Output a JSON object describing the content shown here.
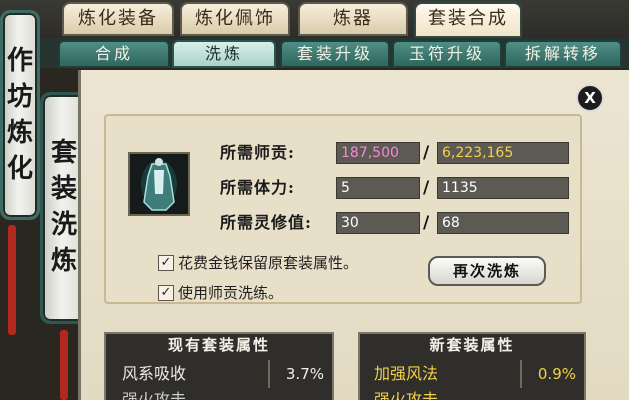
{
  "top_tabs": [
    "炼化装备",
    "炼化佩饰",
    "炼器",
    "套装合成"
  ],
  "sub_tabs": [
    "合成",
    "洗炼",
    "套装升级",
    "玉符升级",
    "拆解转移"
  ],
  "side_tabs": [
    "作坊炼化",
    "套装洗炼"
  ],
  "close_label": "X",
  "requirements": {
    "mentor_points": {
      "label": "所需师贡:",
      "current": "187,500",
      "owned": "6,223,165"
    },
    "stamina": {
      "label": "所需体力:",
      "current": "5",
      "owned": "1135"
    },
    "spirit_cultivation": {
      "label": "所需灵修值:",
      "current": "30",
      "owned": "68"
    },
    "separator": "/"
  },
  "options": {
    "keep_original": {
      "checked": true,
      "label": "花费金钱保留原套装属性。",
      "mark": "✓"
    },
    "use_mentor": {
      "checked": true,
      "label": "使用师贡洗练。",
      "mark": "✓"
    }
  },
  "reroll_button": "再次洗炼",
  "current_attrs": {
    "title": "现有套装属性",
    "rows": [
      {
        "name": "风系吸收",
        "value": "3.7%"
      },
      {
        "name": "强火攻击",
        "value": "..."
      }
    ]
  },
  "new_attrs": {
    "title": "新套装属性",
    "rows": [
      {
        "name": "加强风法",
        "value": "0.9%"
      },
      {
        "name": "强火攻击",
        "value": "..."
      }
    ]
  },
  "colors": {
    "pink_value": "#f48ad8",
    "gold_value": "#f2d14b",
    "new_attr_text": "#f2d14b",
    "tab_teal": "#2f665e"
  },
  "icons": {
    "item": "green-armor-icon",
    "close": "close-icon",
    "check": "check-icon"
  }
}
